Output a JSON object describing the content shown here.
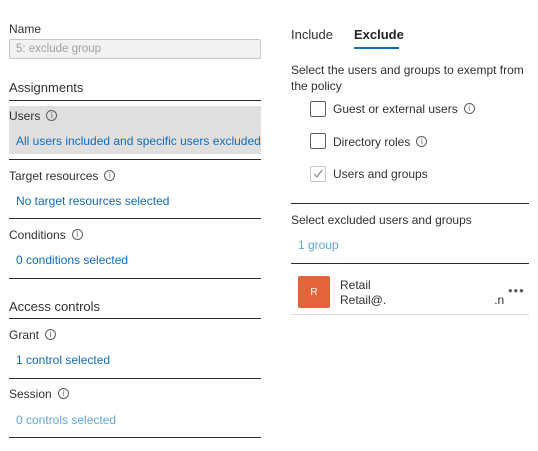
{
  "left": {
    "name_label": "Name",
    "name_value": "5: exclude group",
    "assignments_title": "Assignments",
    "users": {
      "label": "Users",
      "summary": "All users included and specific users excluded"
    },
    "target_resources": {
      "label": "Target resources",
      "summary": "No target resources selected"
    },
    "conditions": {
      "label": "Conditions",
      "summary": "0 conditions selected"
    },
    "access_controls_title": "Access controls",
    "grant": {
      "label": "Grant",
      "summary": "1 control selected"
    },
    "session": {
      "label": "Session",
      "summary": "0 controls selected"
    }
  },
  "right": {
    "tabs": [
      {
        "label": "Include",
        "selected": false
      },
      {
        "label": "Exclude",
        "selected": true
      }
    ],
    "instructions": "Select the users and groups to exempt from the policy",
    "options": [
      {
        "label": "Guest or external users",
        "checked": false,
        "info": true
      },
      {
        "label": "Directory roles",
        "checked": false,
        "info": true
      },
      {
        "label": "Users and groups",
        "checked": true,
        "info": false
      }
    ],
    "excluded_heading": "Select excluded users and groups",
    "group_count": "1 group",
    "group_item": {
      "avatar_letter": "R",
      "name": "Retail",
      "email_start": "Retail@.",
      "email_end": ".n"
    }
  },
  "colors": {
    "link": "#0f6cbd",
    "avatar": "#e3633b",
    "selected_row": "#e1dfdd"
  },
  "icons": {
    "info": "info-icon",
    "checkmark": "checkmark-icon",
    "more": "more-icon"
  }
}
